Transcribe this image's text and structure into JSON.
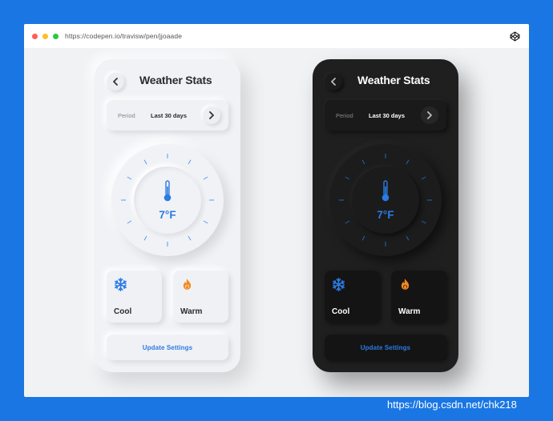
{
  "browser": {
    "url": "https://codepen.io/travisw/pen/jjoaade",
    "logo_icon": "codepen-icon"
  },
  "colors": {
    "page_background": "#1a76e3",
    "accent": "#2a7be4",
    "warm": "#f28a1f",
    "light_surface": "#f1f2f6",
    "dark_surface": "#1f1f1f"
  },
  "light": {
    "title": "Weather Stats",
    "period_label": "Period",
    "period_value": "Last 30 days",
    "temperature": "7°F",
    "modes": [
      {
        "label": "Cool",
        "icon": "snowflake-icon"
      },
      {
        "label": "Warm",
        "icon": "flame-icon"
      }
    ],
    "update_label": "Update Settings"
  },
  "dark": {
    "title": "Weather Stats",
    "period_label": "Period",
    "period_value": "Last 30 days",
    "temperature": "7°F",
    "modes": [
      {
        "label": "Cool",
        "icon": "snowflake-icon"
      },
      {
        "label": "Warm",
        "icon": "flame-icon"
      }
    ],
    "update_label": "Update Settings"
  },
  "watermark": "https://blog.csdn.net/chk218"
}
